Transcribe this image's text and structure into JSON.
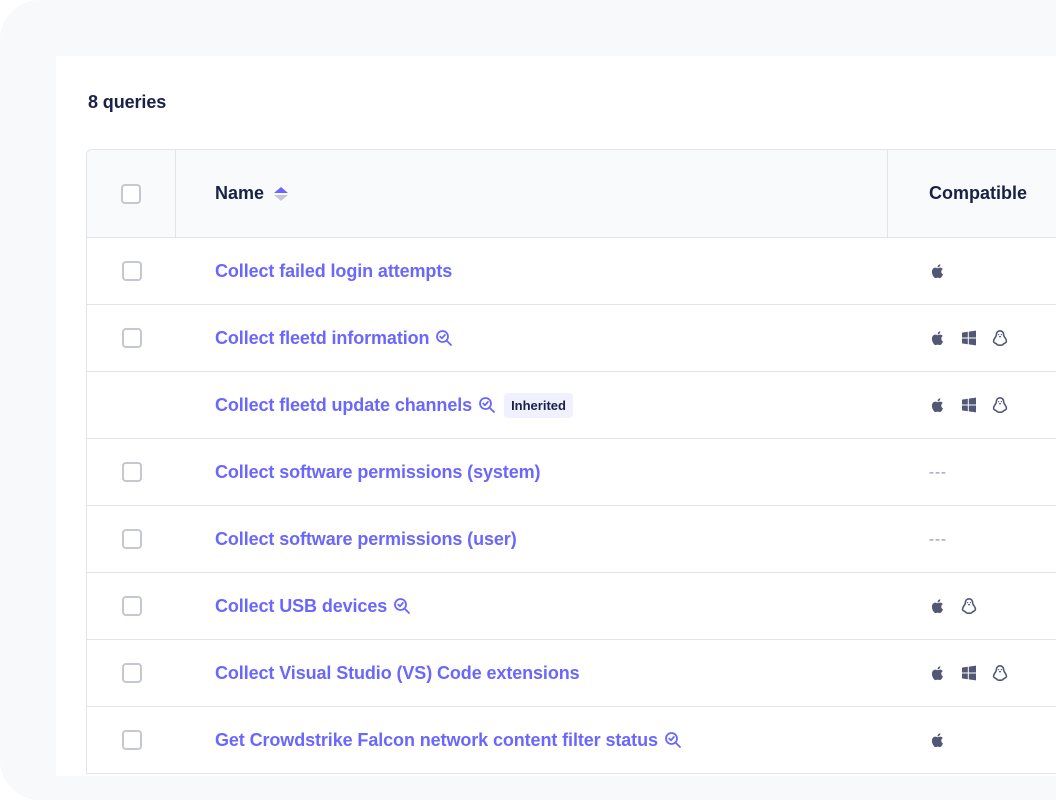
{
  "summary": {
    "query_count_label": "8 queries"
  },
  "table": {
    "columns": {
      "select_all": "",
      "name": "Name",
      "compatible": "Compatible"
    },
    "sort": {
      "column": "name",
      "direction": "ascending"
    },
    "rows": [
      {
        "name": "Collect failed login attempts",
        "selectable": true,
        "observer_icon": false,
        "badge": null,
        "platforms": [
          "apple"
        ],
        "compatible_empty": false
      },
      {
        "name": "Collect fleetd information",
        "selectable": true,
        "observer_icon": true,
        "badge": null,
        "platforms": [
          "apple",
          "windows",
          "linux"
        ],
        "compatible_empty": false
      },
      {
        "name": "Collect fleetd update channels",
        "selectable": false,
        "observer_icon": true,
        "badge": "Inherited",
        "platforms": [
          "apple",
          "windows",
          "linux"
        ],
        "compatible_empty": false
      },
      {
        "name": "Collect software permissions (system)",
        "selectable": true,
        "observer_icon": false,
        "badge": null,
        "platforms": [],
        "compatible_empty": true,
        "compatible_placeholder": "---"
      },
      {
        "name": "Collect software permissions (user)",
        "selectable": true,
        "observer_icon": false,
        "badge": null,
        "platforms": [],
        "compatible_empty": true,
        "compatible_placeholder": "---"
      },
      {
        "name": "Collect USB devices",
        "selectable": true,
        "observer_icon": true,
        "badge": null,
        "platforms": [
          "apple",
          "linux"
        ],
        "compatible_empty": false
      },
      {
        "name": "Collect Visual Studio (VS) Code extensions",
        "selectable": true,
        "observer_icon": false,
        "badge": null,
        "platforms": [
          "apple",
          "windows",
          "linux"
        ],
        "compatible_empty": false
      },
      {
        "name": "Get Crowdstrike Falcon network content filter status",
        "selectable": true,
        "observer_icon": true,
        "badge": null,
        "platforms": [
          "apple"
        ],
        "compatible_empty": false
      }
    ]
  },
  "colors": {
    "link": "#6a67fe",
    "heading": "#192147",
    "icon": "#515774",
    "border": "#e2e4ea",
    "header_bg": "#f9fafc",
    "badge_bg": "#f1f0ff",
    "sort_active": "#6a67fe",
    "sort_inactive": "#c5c7d1"
  },
  "icons": {
    "observer": "magnifier-check-icon",
    "apple": "apple-icon",
    "windows": "windows-icon",
    "linux": "linux-icon"
  }
}
